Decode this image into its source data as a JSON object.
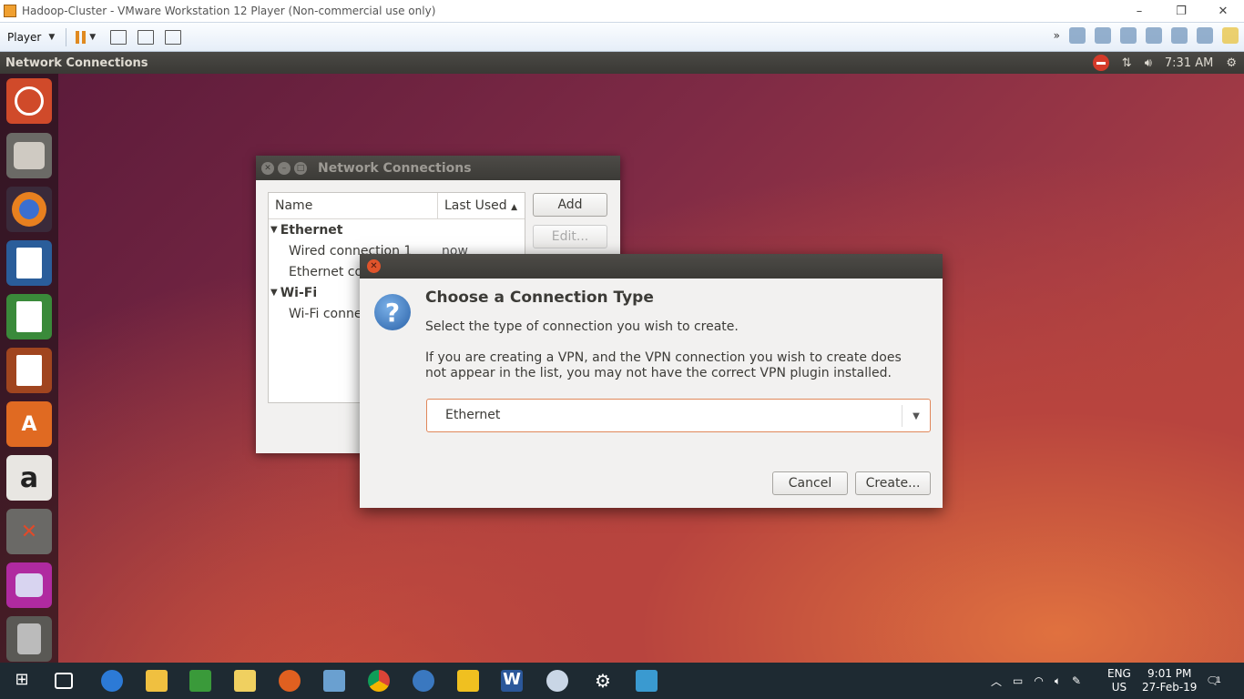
{
  "vmware": {
    "window_title": "Hadoop-Cluster - VMware Workstation 12 Player (Non-commercial use only)",
    "player_menu": "Player",
    "controls": {
      "minimize": "–",
      "restore": "❐",
      "close": "✕"
    }
  },
  "ubuntu_panel": {
    "app_title": "Network Connections",
    "clock": "7:31 AM"
  },
  "launcher": {
    "items": [
      "ubuntu-dash",
      "files",
      "firefox",
      "libreoffice-writer",
      "libreoffice-calc",
      "libreoffice-impress",
      "software-center",
      "amazon",
      "system-settings",
      "network-connections",
      "trash"
    ]
  },
  "network_window": {
    "title": "Network Connections",
    "columns": {
      "name": "Name",
      "last_used": "Last Used"
    },
    "groups": [
      {
        "label": "Ethernet",
        "items": [
          {
            "name": "Wired connection 1",
            "last_used": "now"
          },
          {
            "name": "Ethernet co"
          }
        ]
      },
      {
        "label": "Wi-Fi",
        "items": [
          {
            "name": "Wi-Fi conne"
          }
        ]
      }
    ],
    "buttons": {
      "add": "Add",
      "edit": "Edit..."
    }
  },
  "dialog": {
    "heading": "Choose a Connection Type",
    "text1": "Select the type of connection you wish to create.",
    "text2": "If you are creating a VPN, and the VPN connection you wish to create does not appear in the list, you may not have the correct VPN plugin installed.",
    "selected_type": "Ethernet",
    "cancel": "Cancel",
    "create": "Create..."
  },
  "taskbar": {
    "language": "ENG",
    "region": "US",
    "time": "9:01 PM",
    "date": "27-Feb-19",
    "notifications": "1"
  },
  "colors": {
    "accent": "#e0542b",
    "panel": "#3c3b37"
  }
}
